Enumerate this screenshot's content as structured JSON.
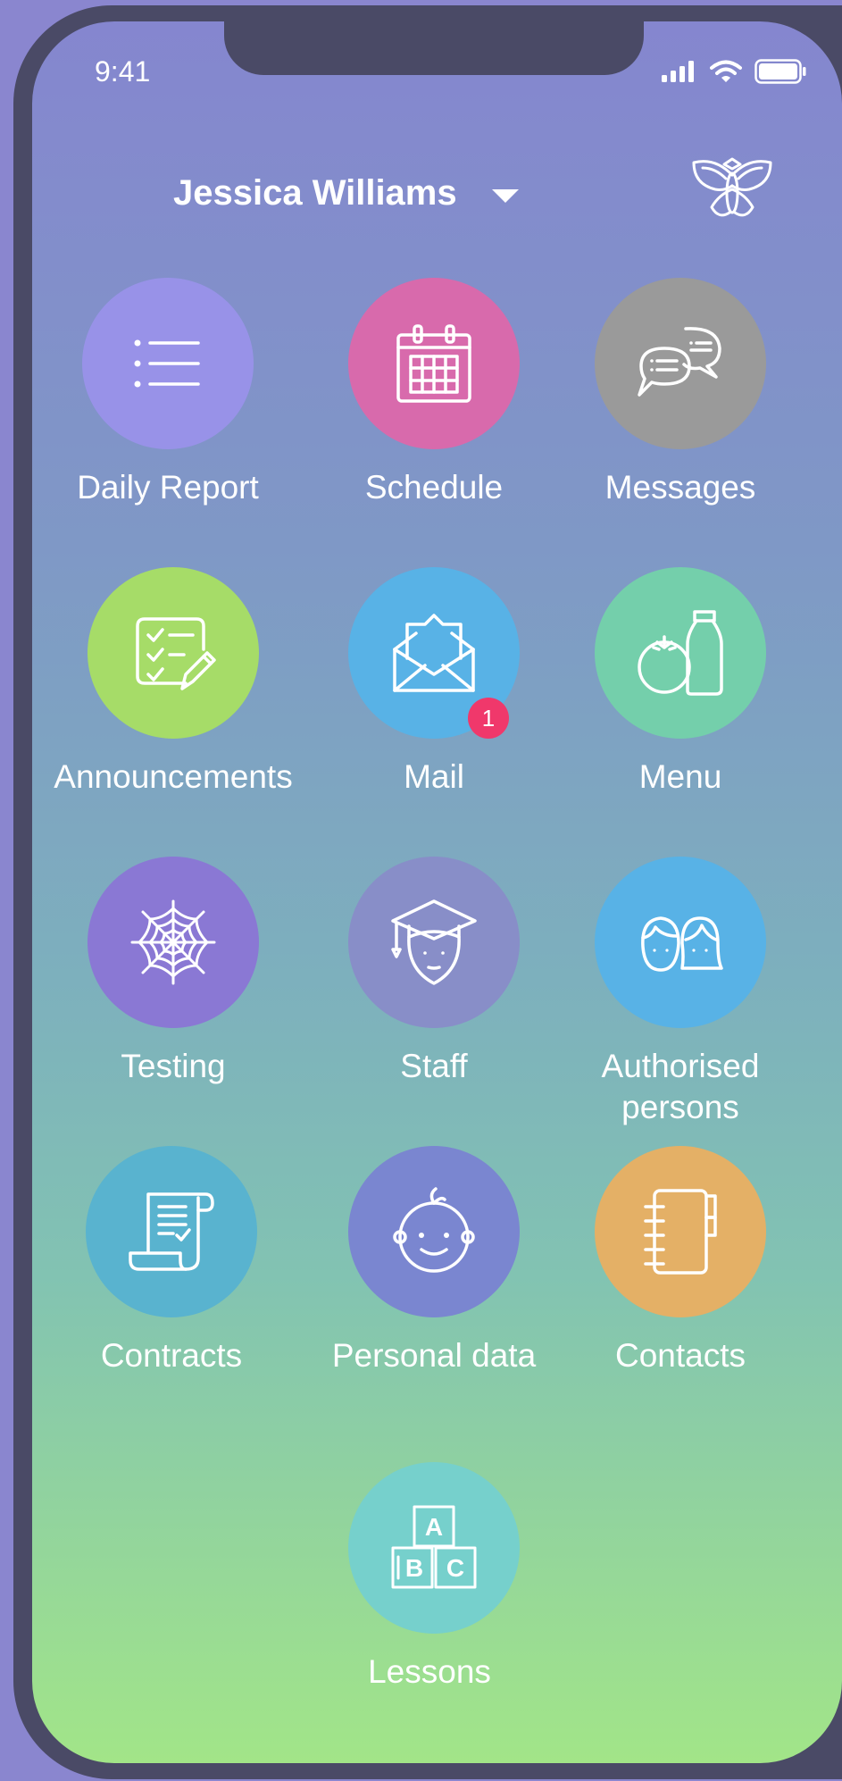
{
  "status_bar": {
    "time": "9:41"
  },
  "header": {
    "user_name": "Jessica Williams"
  },
  "tiles": [
    {
      "label": "Daily Report",
      "icon": "list-icon",
      "color": "#9892e8"
    },
    {
      "label": "Schedule",
      "icon": "calendar-icon",
      "color": "#d86aac"
    },
    {
      "label": "Messages",
      "icon": "chat-bubbles-icon",
      "color": "#9a9a9a"
    },
    {
      "label": "Announcements",
      "icon": "checklist-icon",
      "color": "#a6dc68"
    },
    {
      "label": "Mail",
      "icon": "open-envelope-icon",
      "color": "#58b2e6",
      "badge": "1"
    },
    {
      "label": "Menu",
      "icon": "food-icon",
      "color": "#74cfab"
    },
    {
      "label": "Testing",
      "icon": "spiderweb-icon",
      "color": "#8a78d4"
    },
    {
      "label": "Staff",
      "icon": "graduate-icon",
      "color": "#888ec8"
    },
    {
      "label": "Authorised persons",
      "label_line1": "Authorised",
      "label_line2": "persons",
      "icon": "people-icon",
      "color": "#58b2e6"
    },
    {
      "label": "Contracts",
      "icon": "scroll-icon",
      "color": "#59b3cf"
    },
    {
      "label": "Personal data",
      "icon": "baby-face-icon",
      "color": "#7a86d0"
    },
    {
      "label": "Contacts",
      "icon": "notebook-icon",
      "color": "#e4b066"
    },
    {
      "label": "Lessons",
      "icon": "abc-blocks-icon",
      "color": "#76d0cc"
    }
  ],
  "blocks": {
    "a": "A",
    "b": "B",
    "c": "C"
  }
}
